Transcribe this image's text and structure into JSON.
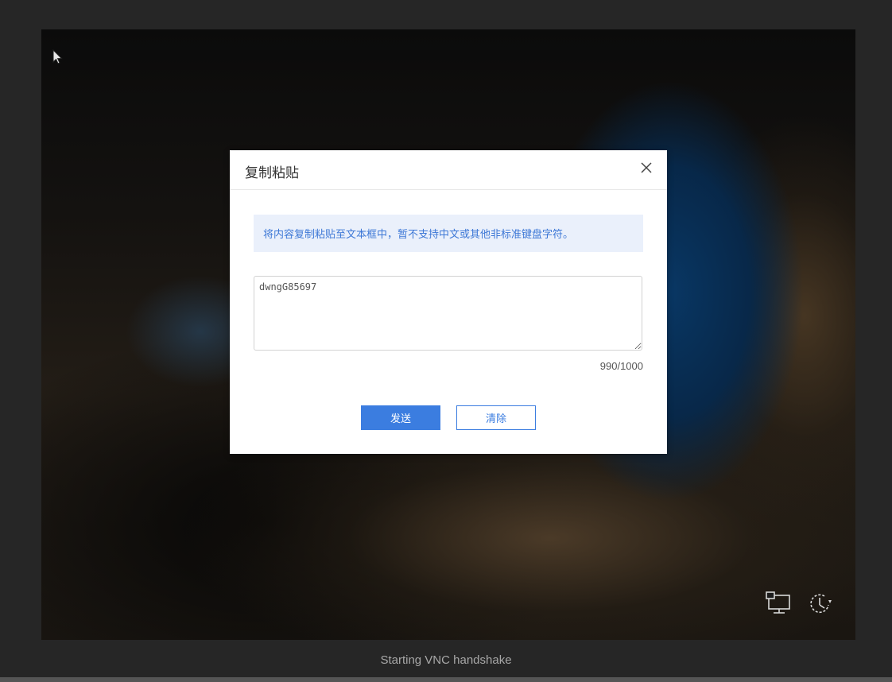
{
  "dialog": {
    "title": "复制粘贴",
    "close_icon": "close-icon",
    "info_text": "将内容复制粘贴至文本框中，暂不支持中文或其他非标准键盘字符。",
    "textarea_value": "dwngG85697",
    "char_counter": "990/1000",
    "send_label": "发送",
    "clear_label": "清除"
  },
  "vnc": {
    "status": "Starting VNC handshake",
    "toolbar_icons": [
      "monitor-network-icon",
      "power-reset-icon"
    ],
    "cursor_icon": "mouse-pointer-icon"
  },
  "colors": {
    "accent": "#3b7de0",
    "info_bg": "#eaf0fb",
    "frame_bg": "#262626"
  }
}
